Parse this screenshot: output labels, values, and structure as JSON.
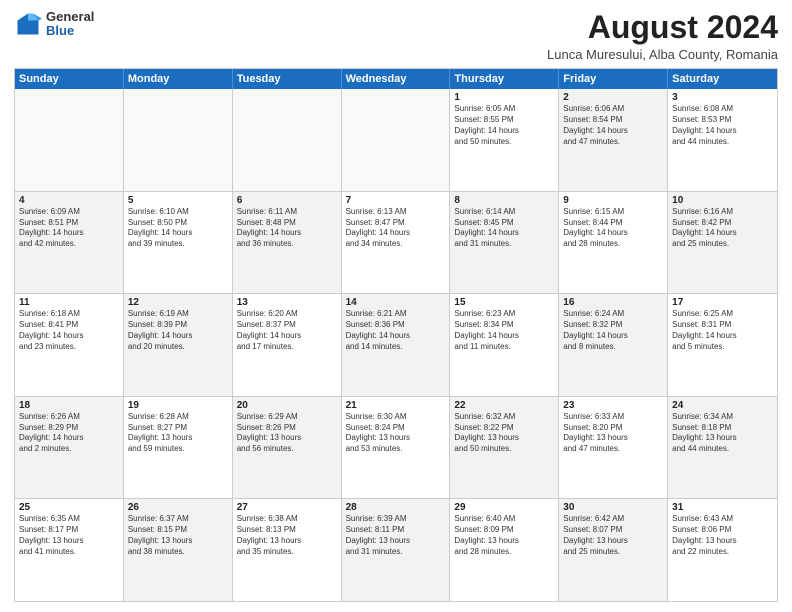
{
  "logo": {
    "general": "General",
    "blue": "Blue"
  },
  "title": "August 2024",
  "subtitle": "Lunca Muresului, Alba County, Romania",
  "header_days": [
    "Sunday",
    "Monday",
    "Tuesday",
    "Wednesday",
    "Thursday",
    "Friday",
    "Saturday"
  ],
  "weeks": [
    [
      {
        "day": "",
        "text": "",
        "empty": true
      },
      {
        "day": "",
        "text": "",
        "empty": true
      },
      {
        "day": "",
        "text": "",
        "empty": true
      },
      {
        "day": "",
        "text": "",
        "empty": true
      },
      {
        "day": "1",
        "text": "Sunrise: 6:05 AM\nSunset: 8:55 PM\nDaylight: 14 hours\nand 50 minutes.",
        "empty": false,
        "shaded": false
      },
      {
        "day": "2",
        "text": "Sunrise: 6:06 AM\nSunset: 8:54 PM\nDaylight: 14 hours\nand 47 minutes.",
        "empty": false,
        "shaded": true
      },
      {
        "day": "3",
        "text": "Sunrise: 6:08 AM\nSunset: 8:53 PM\nDaylight: 14 hours\nand 44 minutes.",
        "empty": false,
        "shaded": false
      }
    ],
    [
      {
        "day": "4",
        "text": "Sunrise: 6:09 AM\nSunset: 8:51 PM\nDaylight: 14 hours\nand 42 minutes.",
        "empty": false,
        "shaded": true
      },
      {
        "day": "5",
        "text": "Sunrise: 6:10 AM\nSunset: 8:50 PM\nDaylight: 14 hours\nand 39 minutes.",
        "empty": false,
        "shaded": false
      },
      {
        "day": "6",
        "text": "Sunrise: 6:11 AM\nSunset: 8:48 PM\nDaylight: 14 hours\nand 36 minutes.",
        "empty": false,
        "shaded": true
      },
      {
        "day": "7",
        "text": "Sunrise: 6:13 AM\nSunset: 8:47 PM\nDaylight: 14 hours\nand 34 minutes.",
        "empty": false,
        "shaded": false
      },
      {
        "day": "8",
        "text": "Sunrise: 6:14 AM\nSunset: 8:45 PM\nDaylight: 14 hours\nand 31 minutes.",
        "empty": false,
        "shaded": true
      },
      {
        "day": "9",
        "text": "Sunrise: 6:15 AM\nSunset: 8:44 PM\nDaylight: 14 hours\nand 28 minutes.",
        "empty": false,
        "shaded": false
      },
      {
        "day": "10",
        "text": "Sunrise: 6:16 AM\nSunset: 8:42 PM\nDaylight: 14 hours\nand 25 minutes.",
        "empty": false,
        "shaded": true
      }
    ],
    [
      {
        "day": "11",
        "text": "Sunrise: 6:18 AM\nSunset: 8:41 PM\nDaylight: 14 hours\nand 23 minutes.",
        "empty": false,
        "shaded": false
      },
      {
        "day": "12",
        "text": "Sunrise: 6:19 AM\nSunset: 8:39 PM\nDaylight: 14 hours\nand 20 minutes.",
        "empty": false,
        "shaded": true
      },
      {
        "day": "13",
        "text": "Sunrise: 6:20 AM\nSunset: 8:37 PM\nDaylight: 14 hours\nand 17 minutes.",
        "empty": false,
        "shaded": false
      },
      {
        "day": "14",
        "text": "Sunrise: 6:21 AM\nSunset: 8:36 PM\nDaylight: 14 hours\nand 14 minutes.",
        "empty": false,
        "shaded": true
      },
      {
        "day": "15",
        "text": "Sunrise: 6:23 AM\nSunset: 8:34 PM\nDaylight: 14 hours\nand 11 minutes.",
        "empty": false,
        "shaded": false
      },
      {
        "day": "16",
        "text": "Sunrise: 6:24 AM\nSunset: 8:32 PM\nDaylight: 14 hours\nand 8 minutes.",
        "empty": false,
        "shaded": true
      },
      {
        "day": "17",
        "text": "Sunrise: 6:25 AM\nSunset: 8:31 PM\nDaylight: 14 hours\nand 5 minutes.",
        "empty": false,
        "shaded": false
      }
    ],
    [
      {
        "day": "18",
        "text": "Sunrise: 6:26 AM\nSunset: 8:29 PM\nDaylight: 14 hours\nand 2 minutes.",
        "empty": false,
        "shaded": true
      },
      {
        "day": "19",
        "text": "Sunrise: 6:28 AM\nSunset: 8:27 PM\nDaylight: 13 hours\nand 59 minutes.",
        "empty": false,
        "shaded": false
      },
      {
        "day": "20",
        "text": "Sunrise: 6:29 AM\nSunset: 8:26 PM\nDaylight: 13 hours\nand 56 minutes.",
        "empty": false,
        "shaded": true
      },
      {
        "day": "21",
        "text": "Sunrise: 6:30 AM\nSunset: 8:24 PM\nDaylight: 13 hours\nand 53 minutes.",
        "empty": false,
        "shaded": false
      },
      {
        "day": "22",
        "text": "Sunrise: 6:32 AM\nSunset: 8:22 PM\nDaylight: 13 hours\nand 50 minutes.",
        "empty": false,
        "shaded": true
      },
      {
        "day": "23",
        "text": "Sunrise: 6:33 AM\nSunset: 8:20 PM\nDaylight: 13 hours\nand 47 minutes.",
        "empty": false,
        "shaded": false
      },
      {
        "day": "24",
        "text": "Sunrise: 6:34 AM\nSunset: 8:18 PM\nDaylight: 13 hours\nand 44 minutes.",
        "empty": false,
        "shaded": true
      }
    ],
    [
      {
        "day": "25",
        "text": "Sunrise: 6:35 AM\nSunset: 8:17 PM\nDaylight: 13 hours\nand 41 minutes.",
        "empty": false,
        "shaded": false
      },
      {
        "day": "26",
        "text": "Sunrise: 6:37 AM\nSunset: 8:15 PM\nDaylight: 13 hours\nand 38 minutes.",
        "empty": false,
        "shaded": true
      },
      {
        "day": "27",
        "text": "Sunrise: 6:38 AM\nSunset: 8:13 PM\nDaylight: 13 hours\nand 35 minutes.",
        "empty": false,
        "shaded": false
      },
      {
        "day": "28",
        "text": "Sunrise: 6:39 AM\nSunset: 8:11 PM\nDaylight: 13 hours\nand 31 minutes.",
        "empty": false,
        "shaded": true
      },
      {
        "day": "29",
        "text": "Sunrise: 6:40 AM\nSunset: 8:09 PM\nDaylight: 13 hours\nand 28 minutes.",
        "empty": false,
        "shaded": false
      },
      {
        "day": "30",
        "text": "Sunrise: 6:42 AM\nSunset: 8:07 PM\nDaylight: 13 hours\nand 25 minutes.",
        "empty": false,
        "shaded": true
      },
      {
        "day": "31",
        "text": "Sunrise: 6:43 AM\nSunset: 8:06 PM\nDaylight: 13 hours\nand 22 minutes.",
        "empty": false,
        "shaded": false
      }
    ]
  ]
}
